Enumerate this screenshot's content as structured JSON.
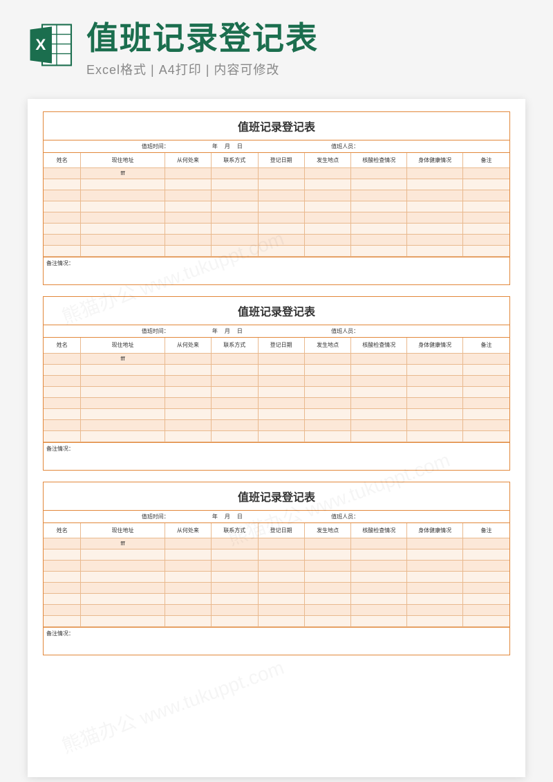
{
  "header": {
    "main_title": "值班记录登记表",
    "sub_title": "Excel格式 | A4打印 | 内容可修改",
    "icon_label": "excel-icon"
  },
  "form": {
    "title": "值班记录登记表",
    "date_line": {
      "label": "值班时间：",
      "year": "年",
      "month": "月",
      "day": "日",
      "staff_label": "值班人员："
    },
    "columns": {
      "name": "姓名",
      "addr": "现住地址",
      "from": "从何处来",
      "contact": "联系方式",
      "regdate": "登记日期",
      "place": "发生地点",
      "test": "核酸检查情况",
      "health": "身体健康情况",
      "remark": "备注"
    },
    "sample_addr": "fff",
    "notes_label": "备注情况：",
    "row_count": 8
  },
  "watermark_text": "熊猫办公 www.tukuppt.com"
}
